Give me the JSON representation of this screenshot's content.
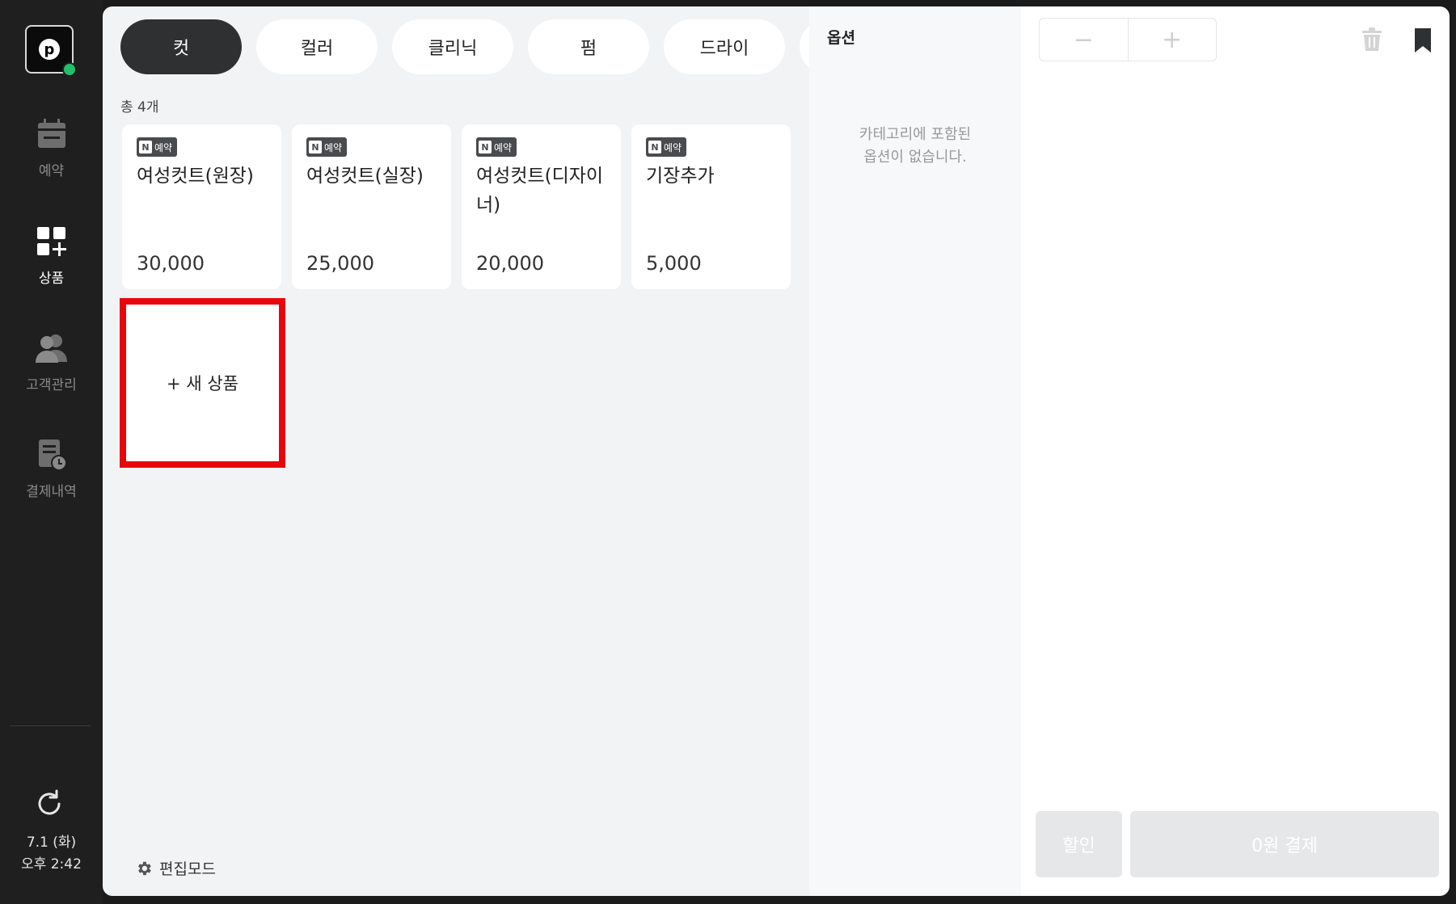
{
  "sidebar": {
    "logo_letter": "p",
    "items": [
      {
        "label": "예약",
        "icon": "calendar-icon",
        "active": false
      },
      {
        "label": "상품",
        "icon": "products-grid-icon",
        "active": true
      },
      {
        "label": "고객관리",
        "icon": "customers-icon",
        "active": false
      },
      {
        "label": "결제내역",
        "icon": "payment-history-icon",
        "active": false
      }
    ],
    "date": "7.1 (화)",
    "time": "오후 2:42"
  },
  "tabs": [
    {
      "label": "컷",
      "active": true
    },
    {
      "label": "컬러",
      "active": false
    },
    {
      "label": "클리닉",
      "active": false
    },
    {
      "label": "펌",
      "active": false
    },
    {
      "label": "드라이",
      "active": false
    }
  ],
  "count_label": "총 4개",
  "products": [
    {
      "badge_n": "N",
      "badge": "예약",
      "name": "여성컷트(원장)",
      "price": "30,000"
    },
    {
      "badge_n": "N",
      "badge": "예약",
      "name": "여성컷트(실장)",
      "price": "25,000"
    },
    {
      "badge_n": "N",
      "badge": "예약",
      "name": "여성컷트(디자이너)",
      "price": "20,000"
    },
    {
      "badge_n": "N",
      "badge": "예약",
      "name": "기장추가",
      "price": "5,000"
    }
  ],
  "new_product_label": "+ 새 상품",
  "edit_mode_label": "편집모드",
  "options": {
    "title": "옵션",
    "empty_line1": "카테고리에 포함된",
    "empty_line2": "옵션이 없습니다."
  },
  "order": {
    "minus": "−",
    "plus": "+",
    "discount_label": "할인",
    "pay_label": "0원 결제"
  },
  "colors": {
    "active_tab": "#2f3032",
    "highlight": "#e8060c",
    "status_dot": "#21c06a"
  }
}
